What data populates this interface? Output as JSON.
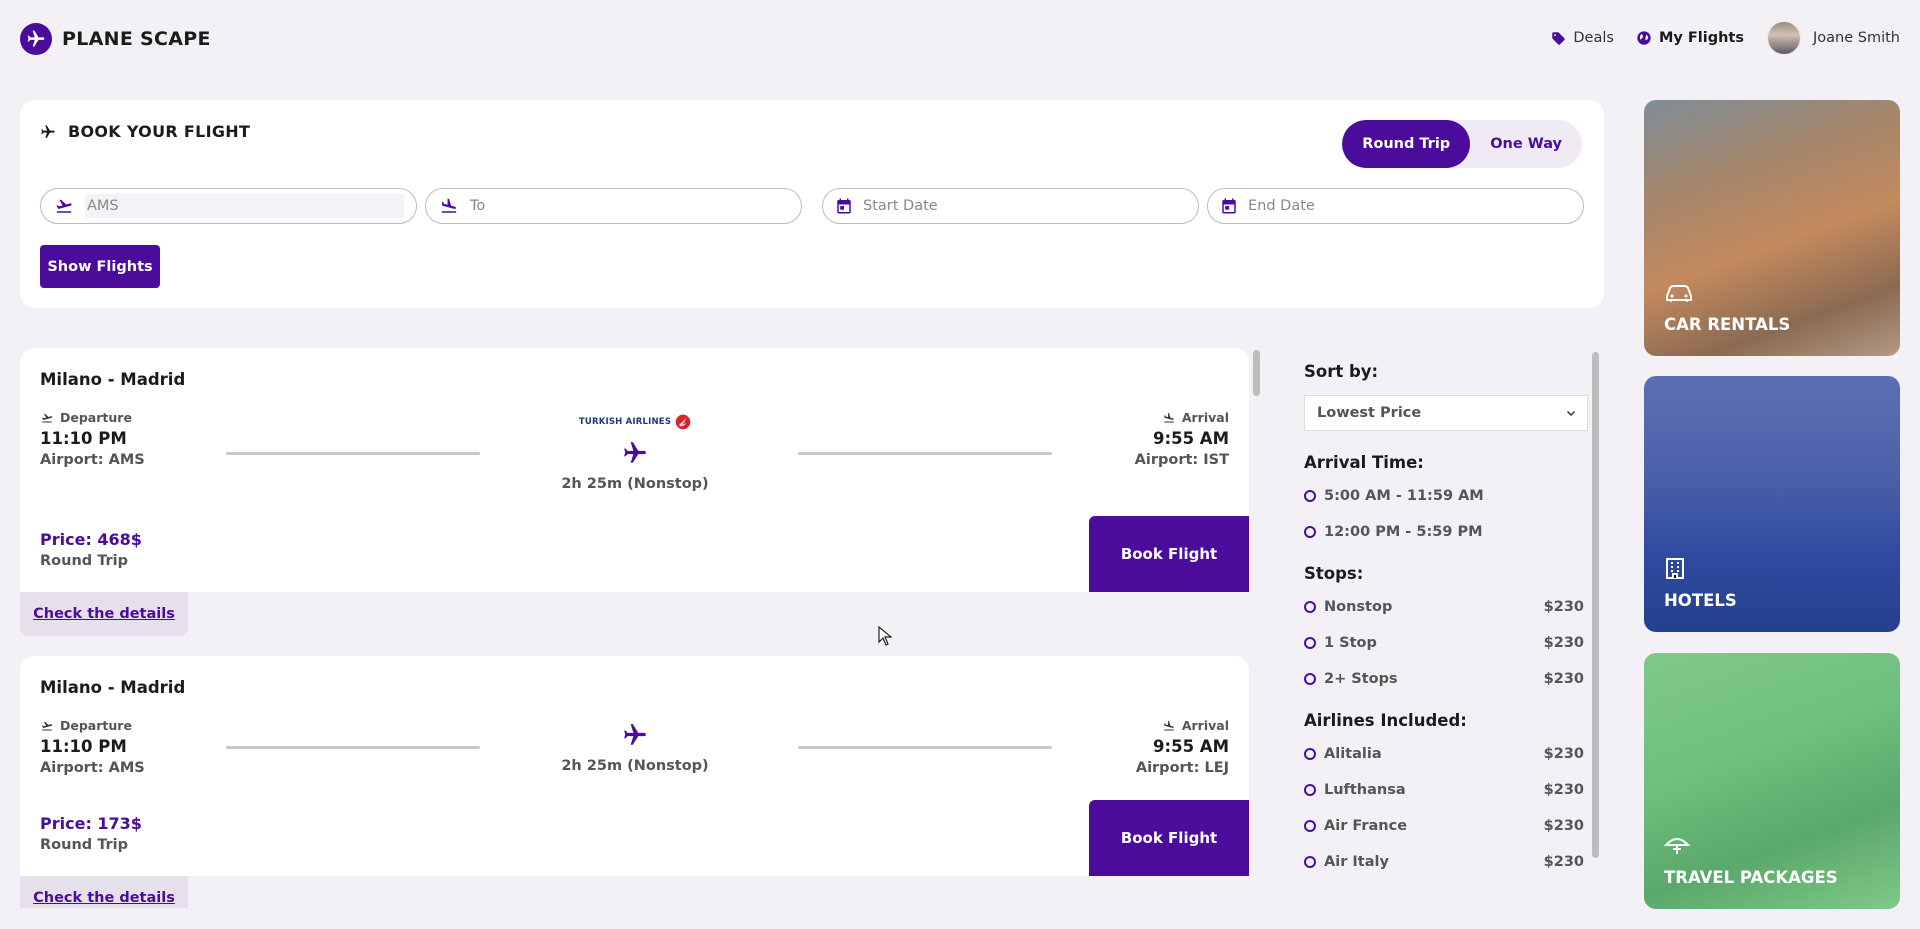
{
  "brand": {
    "name": "PLANE SCAPE",
    "accent": "#4b0c9c"
  },
  "topnav": {
    "deals": "Deals",
    "my_flights": "My Flights",
    "user_name": "Joane Smith"
  },
  "booking": {
    "title": "BOOK YOUR FLIGHT",
    "round_trip": "Round Trip",
    "one_way": "One Way",
    "from_value": "AMS",
    "to_placeholder": "To",
    "start_placeholder": "Start Date",
    "end_placeholder": "End Date",
    "show_flights": "Show Flights"
  },
  "flights": [
    {
      "route": "Milano - Madrid",
      "departure_label": "Departure",
      "departure_time": "11:10 PM",
      "departure_airport": "Airport: AMS",
      "airline_logo": "TURKISH AIRLINES",
      "duration": "2h 25m (Nonstop)",
      "arrival_label": "Arrival",
      "arrival_time": "9:55 AM",
      "arrival_airport": "Airport: IST",
      "price": "Price: 468$",
      "trip_type": "Round Trip",
      "book_label": "Book Flight",
      "details_label": "Check the details"
    },
    {
      "route": "Milano - Madrid",
      "departure_label": "Departure",
      "departure_time": "11:10 PM",
      "departure_airport": "Airport: AMS",
      "duration": "2h 25m (Nonstop)",
      "arrival_label": "Arrival",
      "arrival_time": "9:55 AM",
      "arrival_airport": "Airport: LEJ",
      "price": "Price: 173$",
      "trip_type": "Round Trip",
      "book_label": "Book Flight",
      "details_label": "Check the details"
    }
  ],
  "filters": {
    "sort_title": "Sort by:",
    "sort_value": "Lowest Price",
    "arrival_title": "Arrival Time:",
    "arrival_options": [
      "5:00 AM - 11:59 AM",
      "12:00 PM - 5:59 PM"
    ],
    "stops_title": "Stops:",
    "stops": [
      {
        "label": "Nonstop",
        "price": "$230"
      },
      {
        "label": "1 Stop",
        "price": "$230"
      },
      {
        "label": "2+ Stops",
        "price": "$230"
      }
    ],
    "airlines_title": "Airlines Included:",
    "airlines": [
      {
        "label": "Alitalia",
        "price": "$230"
      },
      {
        "label": "Lufthansa",
        "price": "$230"
      },
      {
        "label": "Air France",
        "price": "$230"
      },
      {
        "label": "Air Italy",
        "price": "$230"
      }
    ]
  },
  "tiles": {
    "car_rentals": "CAR RENTALS",
    "hotels": "HOTELS",
    "travel_packages": "TRAVEL PACKAGES"
  }
}
